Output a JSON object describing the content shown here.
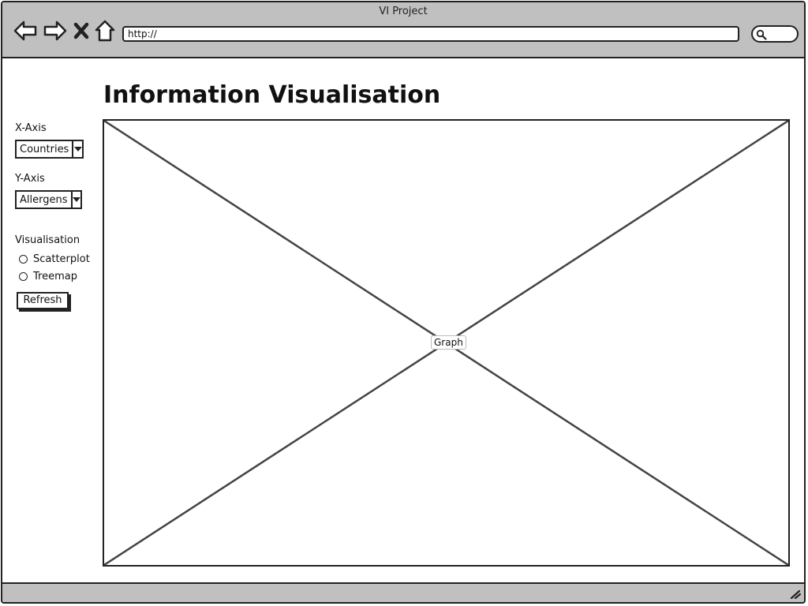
{
  "window": {
    "title": "VI Project",
    "url": "http://"
  },
  "nav": {
    "back_icon": "back-arrow-icon",
    "forward_icon": "forward-arrow-icon",
    "stop_icon": "close-icon",
    "home_icon": "home-icon",
    "search_icon": "search-icon"
  },
  "page": {
    "title": "Information Visualisation"
  },
  "controls": {
    "x_axis": {
      "label": "X-Axis",
      "selected": "Countries"
    },
    "y_axis": {
      "label": "Y-Axis",
      "selected": "Allergens"
    },
    "visualisation": {
      "label": "Visualisation",
      "options": [
        "Scatterplot",
        "Treemap"
      ]
    },
    "refresh_label": "Refresh"
  },
  "graph": {
    "label": "Graph"
  },
  "colors": {
    "chrome": "#c0c0c0",
    "stroke": "#222222",
    "background": "#ffffff"
  }
}
